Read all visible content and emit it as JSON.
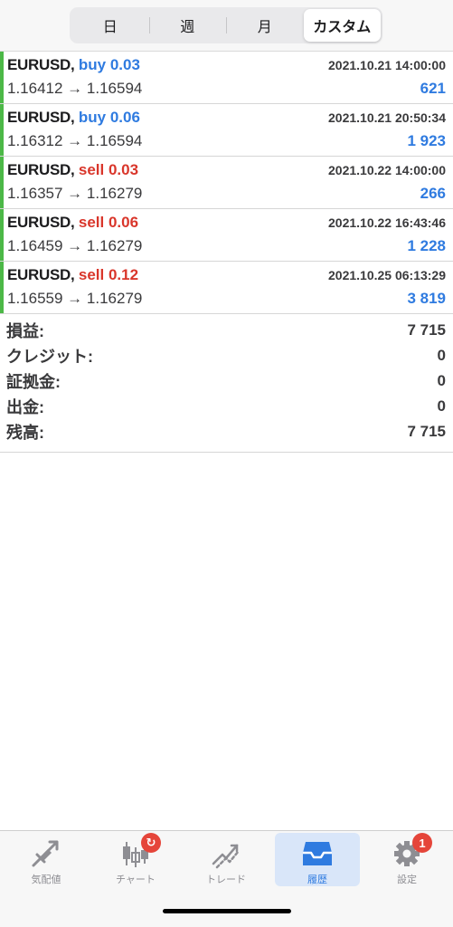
{
  "period_tabs": [
    {
      "label": "日"
    },
    {
      "label": "週"
    },
    {
      "label": "月"
    },
    {
      "label": "カスタム",
      "active": true
    }
  ],
  "trades": [
    {
      "symbol": "EURUSD,",
      "side": "buy",
      "side_label": "buy 0.03",
      "time": "2021.10.21 14:00:00",
      "prices": "1.16412 → 1.16594",
      "profit": "621"
    },
    {
      "symbol": "EURUSD,",
      "side": "buy",
      "side_label": "buy 0.06",
      "time": "2021.10.21 20:50:34",
      "prices": "1.16312 → 1.16594",
      "profit": "1 923"
    },
    {
      "symbol": "EURUSD,",
      "side": "sell",
      "side_label": "sell 0.03",
      "time": "2021.10.22 14:00:00",
      "prices": "1.16357 → 1.16279",
      "profit": "266"
    },
    {
      "symbol": "EURUSD,",
      "side": "sell",
      "side_label": "sell 0.06",
      "time": "2021.10.22 16:43:46",
      "prices": "1.16459 → 1.16279",
      "profit": "1 228"
    },
    {
      "symbol": "EURUSD,",
      "side": "sell",
      "side_label": "sell 0.12",
      "time": "2021.10.25 06:13:29",
      "prices": "1.16559 → 1.16279",
      "profit": "3 819"
    }
  ],
  "summary": [
    {
      "label": "損益:",
      "value": "7 715"
    },
    {
      "label": "クレジット:",
      "value": "0"
    },
    {
      "label": "証拠金:",
      "value": "0"
    },
    {
      "label": "出金:",
      "value": "0"
    },
    {
      "label": "残高:",
      "value": "7 715"
    }
  ],
  "tabbar": [
    {
      "label": "気配値",
      "icon": "quotes-icon"
    },
    {
      "label": "チャート",
      "icon": "chart-icon",
      "badge": "refresh"
    },
    {
      "label": "トレード",
      "icon": "trade-icon"
    },
    {
      "label": "履歴",
      "icon": "history-icon",
      "active": true
    },
    {
      "label": "設定",
      "icon": "settings-icon",
      "badge": "1"
    }
  ],
  "colors": {
    "buy": "#2f7be0",
    "sell": "#d9362b",
    "accent_bar": "#4cb847",
    "profit": "#2f7be0",
    "badge": "#e5453a"
  }
}
